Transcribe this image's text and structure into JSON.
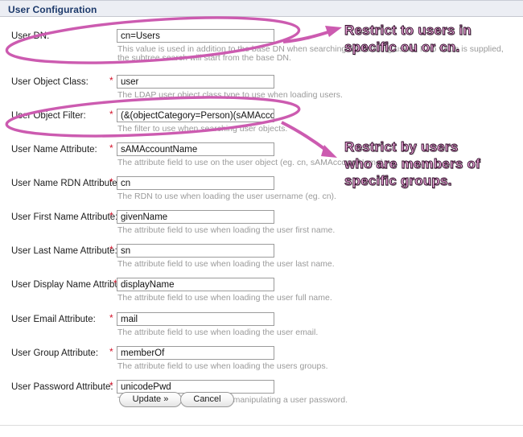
{
  "panel": {
    "title": "User Configuration"
  },
  "fields": [
    {
      "label": "User DN:",
      "required": false,
      "value": "cn=Users",
      "placeholder": "",
      "help": "This value is used in addition to the base DN when searching and loading users. If no value is supplied,",
      "help2": "the subtree search will start from the base DN."
    },
    {
      "label": "User Object Class:",
      "required": true,
      "value": "user",
      "placeholder": "",
      "help": "The LDAP user object class type to use when loading users.",
      "help2": ""
    },
    {
      "label": "User Object Filter:",
      "required": true,
      "value": "(&(objectCategory=Person)(sAMAccountName=*))",
      "placeholder": "",
      "help": "The filter to use when searching user objects.",
      "help2": ""
    },
    {
      "label": "User Name Attribute:",
      "required": true,
      "value": "sAMAccountName",
      "placeholder": "",
      "help": "The attribute field to use on the user object (eg. cn, sAMAccountName).",
      "help2": ""
    },
    {
      "label": "User Name RDN Attribute:",
      "required": true,
      "value": "cn",
      "placeholder": "",
      "help": "The RDN to use when loading the user username (eg. cn).",
      "help2": ""
    },
    {
      "label": "User First Name Attribute:",
      "required": true,
      "value": "givenName",
      "placeholder": "",
      "help": "The attribute field to use when loading the user first name.",
      "help2": ""
    },
    {
      "label": "User Last Name Attribute:",
      "required": true,
      "value": "sn",
      "placeholder": "",
      "help": "The attribute field to use when loading the user last name.",
      "help2": ""
    },
    {
      "label": "User Display Name Attribute:",
      "required": true,
      "value": "displayName",
      "placeholder": "",
      "help": "The attribute field to use when loading the user full name.",
      "help2": ""
    },
    {
      "label": "User Email Attribute:",
      "required": true,
      "value": "mail",
      "placeholder": "",
      "help": "The attribute field to use when loading the user email.",
      "help2": ""
    },
    {
      "label": "User Group Attribute:",
      "required": true,
      "value": "memberOf",
      "placeholder": "",
      "help": "The attribute field to use when loading the users groups.",
      "help2": ""
    },
    {
      "label": "User Password Attribute:",
      "required": true,
      "value": "unicodePwd",
      "placeholder": "",
      "help": "The attribute field to use when manipulating a user password.",
      "help2": ""
    }
  ],
  "buttons": {
    "update_label": "Update »",
    "cancel_label": "Cancel"
  },
  "annotations": [
    {
      "text": "Restrict to users in\nspecific ou or cn.",
      "color": "#e88ed2",
      "target_field": "User DN:"
    },
    {
      "text": "Restrict by users\nwho are members of\nspecific groups.",
      "color": "#e88ed2",
      "target_field": "User Object Filter:"
    }
  ],
  "theme": {
    "header_bg": "#eceef4",
    "header_text": "#1d3a6b",
    "required_star": "#d4122a",
    "help_text": "#9a9a9a",
    "annotation_pink": "#cc5bb0"
  }
}
